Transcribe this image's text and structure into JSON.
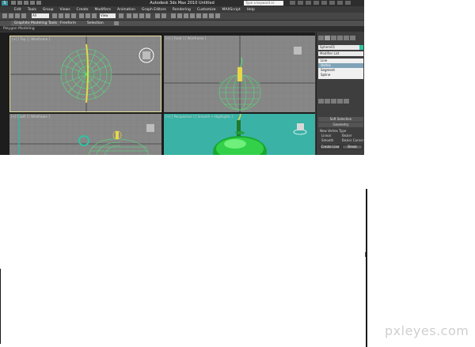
{
  "titlebar": {
    "window_title": "Autodesk 3ds Max  2010   Untitled",
    "search_placeholder": "Type a keyword or phrase"
  },
  "menubar": {
    "items": [
      "Edit",
      "Tools",
      "Group",
      "Views",
      "Create",
      "Modifiers",
      "Animation",
      "Graph Editors",
      "Rendering",
      "Customize",
      "MAXScript",
      "Help"
    ]
  },
  "toolbar": {
    "selection_filter": "All",
    "reference_coord": "View"
  },
  "ribbon": {
    "tabs": [
      "Graphite Modeling Tools",
      "Freeform",
      "Selection"
    ],
    "active_panel": "Polygon Modeling"
  },
  "viewports": {
    "top_label": "[+] [ Top ] [ Wireframe ]",
    "front_label": "[+] [ Front ] [ Wireframe ]",
    "left_label": "[+] [ Left ] [ Wireframe ]",
    "persp_label": "[+] [ Perspective ] [ Smooth + Highlights ]"
  },
  "command_panel": {
    "object_name": "Sphere01",
    "modifier_list": "Modifier List",
    "stack": [
      "Line",
      "Vertex",
      "Segment",
      "Spline"
    ],
    "stack_selected": "Vertex",
    "rollout_soft": "Soft Selection",
    "rollout_geometry": "Geometry",
    "new_vertex_type": "New Vertex Type",
    "opt_linear": "Linear",
    "opt_bezier": "Bezier",
    "opt_smooth": "Smooth",
    "opt_bezier_corner": "Bezier Corner",
    "btn_create_line": "Create Line",
    "btn_break": "Break",
    "swatch_color": "#2ec4a3"
  },
  "watermark": "pxleyes.com",
  "colors": {
    "viewport_bg": "#878787",
    "wire_green": "#55e07a",
    "persp_bg": "#3ab2a6"
  }
}
